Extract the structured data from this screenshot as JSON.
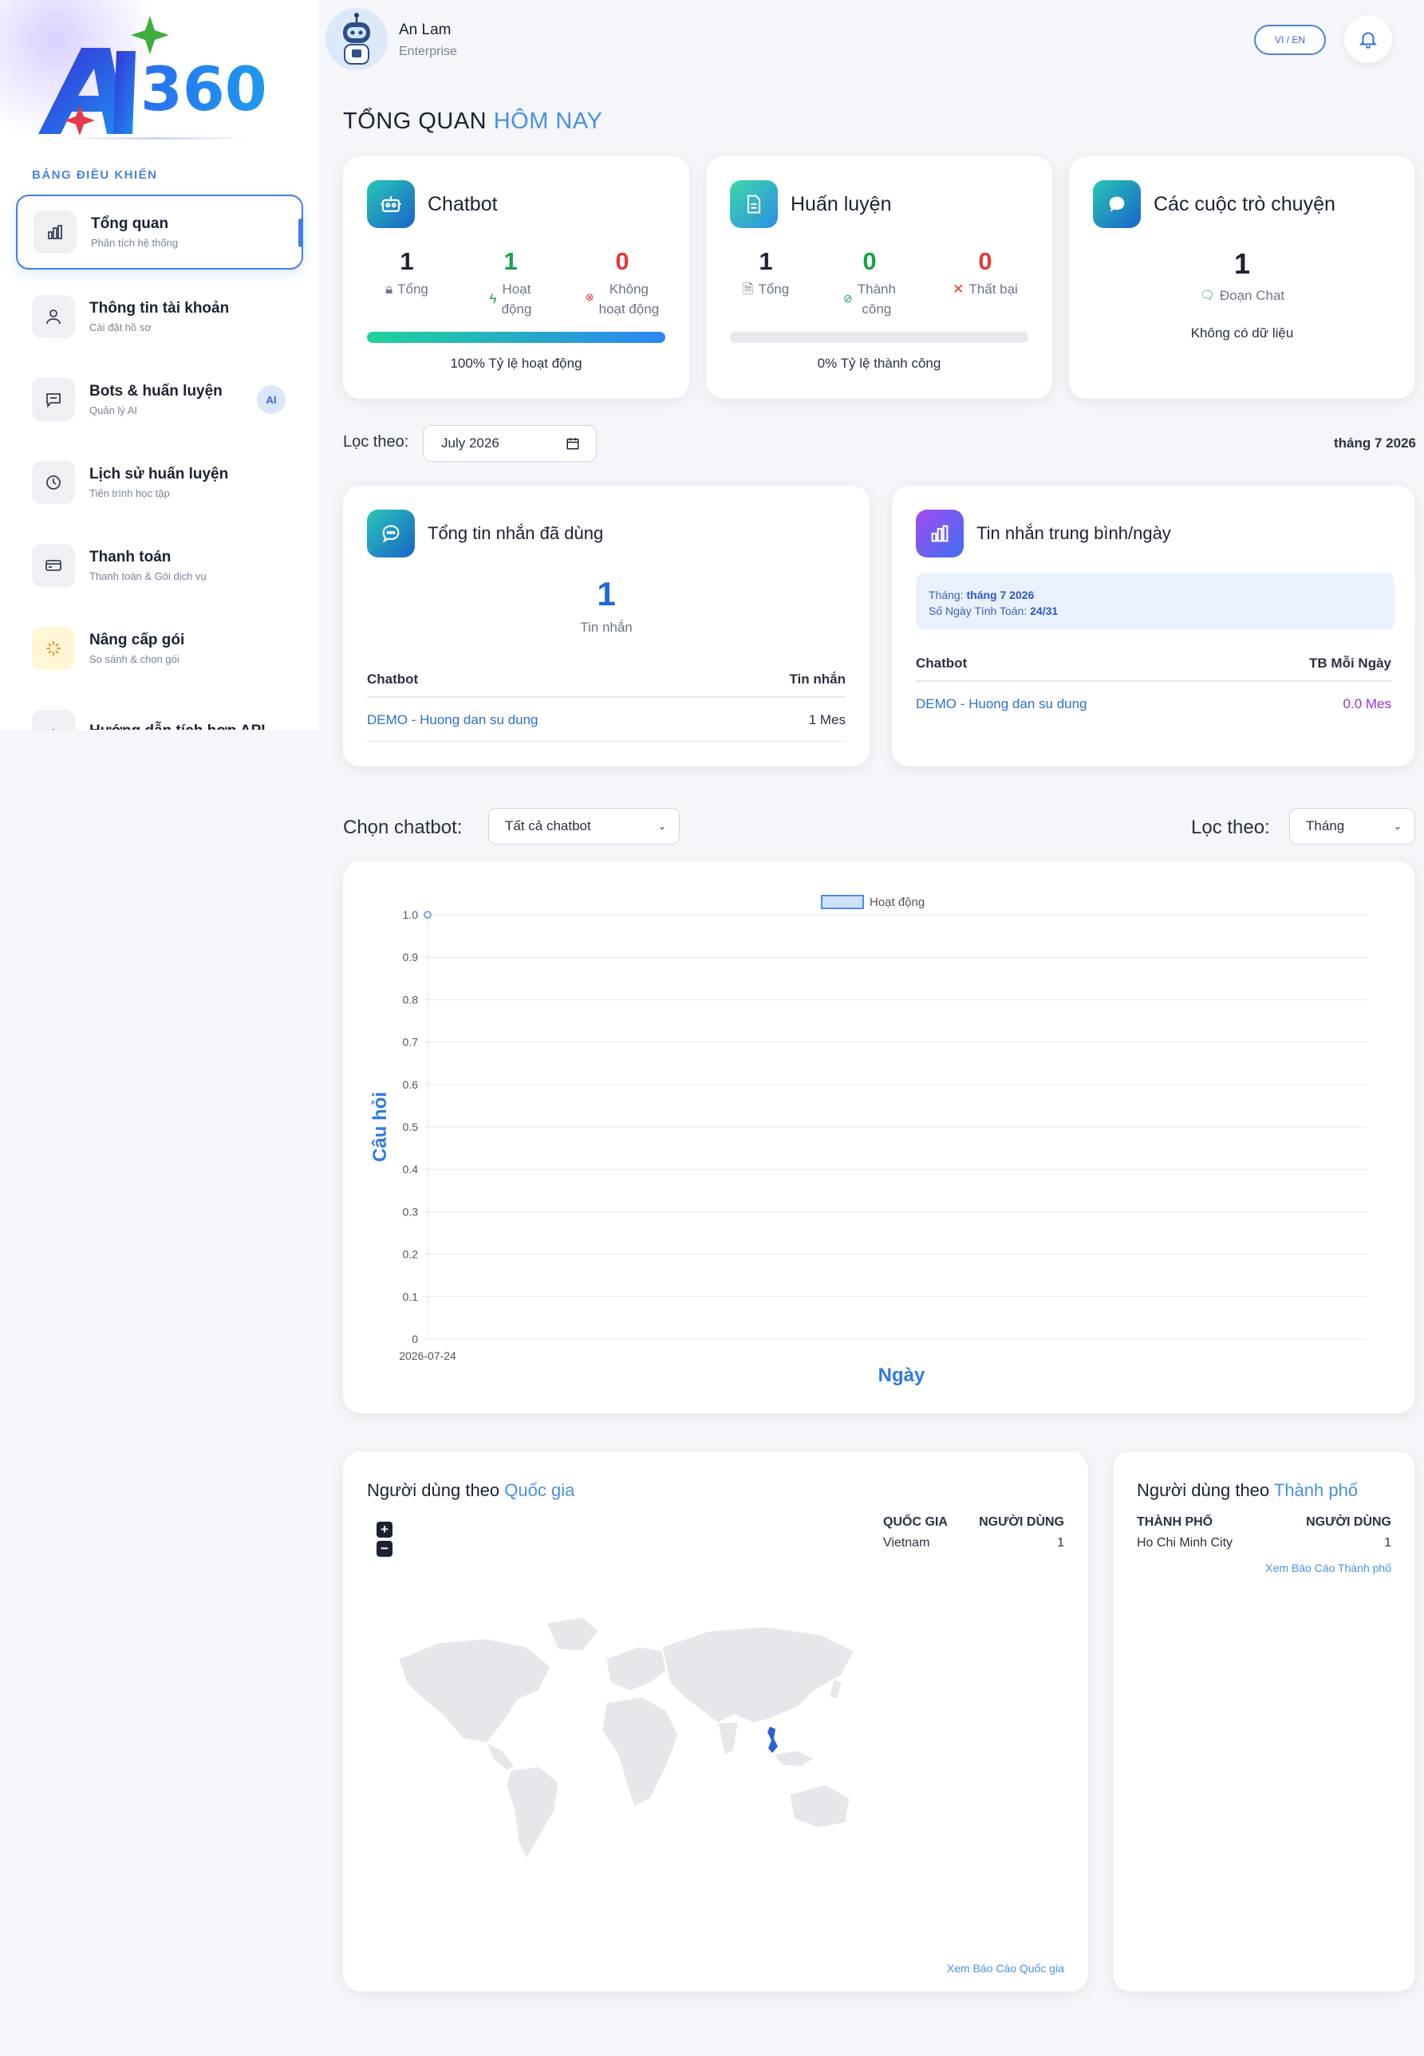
{
  "sidebar": {
    "logo_text": "AI360",
    "section_label": "BẢNG ĐIỀU KHIỂN",
    "items": [
      {
        "title": "Tổng quan",
        "subtitle": "Phân tích hệ thống",
        "icon": "bar-chart-icon",
        "active": true
      },
      {
        "title": "Thông tin tài khoản",
        "subtitle": "Cài đặt hồ sơ",
        "icon": "user-icon"
      },
      {
        "title": "Bots & huấn luyện",
        "subtitle": "Quản lý AI",
        "icon": "chat-icon",
        "badge": "AI"
      },
      {
        "title": "Lịch sử huấn luyện",
        "subtitle": "Tiến trình học tập",
        "icon": "clock-icon"
      },
      {
        "title": "Thanh toán",
        "subtitle": "Thanh toán & Gói dịch vụ",
        "icon": "card-icon"
      },
      {
        "title": "Nâng cấp gói",
        "subtitle": "So sánh & chọn gói",
        "icon": "sparkle-icon"
      },
      {
        "title": "Hướng dẫn tích hợp API",
        "subtitle": "",
        "icon": "api-icon"
      }
    ]
  },
  "header": {
    "user_name": "An Lam",
    "user_plan": "Enterprise",
    "lang_switch": "VI / EN",
    "title_main": "TỔNG QUAN",
    "title_accent": "HÔM NAY"
  },
  "stats": {
    "chatbot": {
      "title": "Chatbot",
      "total": "1",
      "total_label": "Tổng",
      "active": "1",
      "active_label_1": "Hoạt",
      "active_label_2": "động",
      "inactive": "0",
      "inactive_label_1": "Không",
      "inactive_label_2": "hoạt động",
      "progress": 1.0,
      "progress_label": "100% Tỷ lệ hoạt động"
    },
    "training": {
      "title": "Huấn luyện",
      "total": "1",
      "total_label": "Tổng",
      "success": "0",
      "success_label_1": "Thành",
      "success_label_2": "công",
      "failed": "0",
      "failed_label": "Thất bại",
      "progress": 0.0,
      "progress_label": "0% Tỷ lệ thành công"
    },
    "conversations": {
      "title": "Các cuộc trò chuyện",
      "count": "1",
      "count_label": "Đoạn Chat",
      "empty": "Không có dữ liệu"
    }
  },
  "filter": {
    "label": "Lọc theo:",
    "date_value": "July 2026",
    "month_display": "tháng 7 2026"
  },
  "messages_used": {
    "title": "Tổng tin nhắn đã dùng",
    "count": "1",
    "count_label": "Tin nhắn",
    "col_chatbot": "Chatbot",
    "col_messages": "Tin nhắn",
    "rows": [
      {
        "chatbot": "DEMO - Huong dan su dung",
        "value": "1 Mes"
      }
    ]
  },
  "avg_messages": {
    "title": "Tin nhắn trung bình/ngày",
    "month_label": "Tháng:",
    "month_value": "tháng 7 2026",
    "days_label": "Số Ngày Tính Toán:",
    "days_value": "24/31",
    "col_chatbot": "Chatbot",
    "col_avg": "TB Mỗi Ngày",
    "rows": [
      {
        "chatbot": "DEMO - Huong dan su dung",
        "value": "0.0 Mes"
      }
    ]
  },
  "chart_controls": {
    "chatbot_label": "Chọn chatbot:",
    "chatbot_value": "Tất cả chatbot",
    "filter_label": "Lọc theo:",
    "filter_value": "Tháng"
  },
  "chart_data": {
    "type": "line",
    "title": "",
    "xlabel": "Ngày",
    "ylabel": "Câu hỏi",
    "x": [
      "2026-07-24"
    ],
    "series": [
      {
        "name": "Hoạt động",
        "values": [
          1.0
        ],
        "color": "#4a8fe8"
      }
    ],
    "ylim": [
      0,
      1.0
    ],
    "yticks": [
      "0",
      "0.1",
      "0.2",
      "0.3",
      "0.4",
      "0.5",
      "0.6",
      "0.7",
      "0.8",
      "0.9",
      "1.0"
    ],
    "grid": true,
    "legend": "top-center"
  },
  "country_users": {
    "title_main": "Người dùng theo",
    "title_accent": "Quốc gia",
    "col_country": "QUỐC GIA",
    "col_users": "NGƯỜI DÙNG",
    "rows": [
      {
        "name": "Vietnam",
        "users": "1"
      }
    ],
    "zoom_in": "+",
    "zoom_out": "−",
    "report_link": "Xem Báo Cáo Quốc gia"
  },
  "city_users": {
    "title_main": "Người dùng theo",
    "title_accent": "Thành phố",
    "col_city": "THÀNH PHỐ",
    "col_users": "NGƯỜI DÙNG",
    "rows": [
      {
        "name": "Ho Chi Minh City",
        "users": "1"
      }
    ],
    "report_link": "Xem Báo Cáo Thành phố"
  },
  "colors": {
    "accent": "#4a8fe8",
    "success": "#17a34a",
    "danger": "#e53935",
    "purple": "#9b2fe0"
  }
}
